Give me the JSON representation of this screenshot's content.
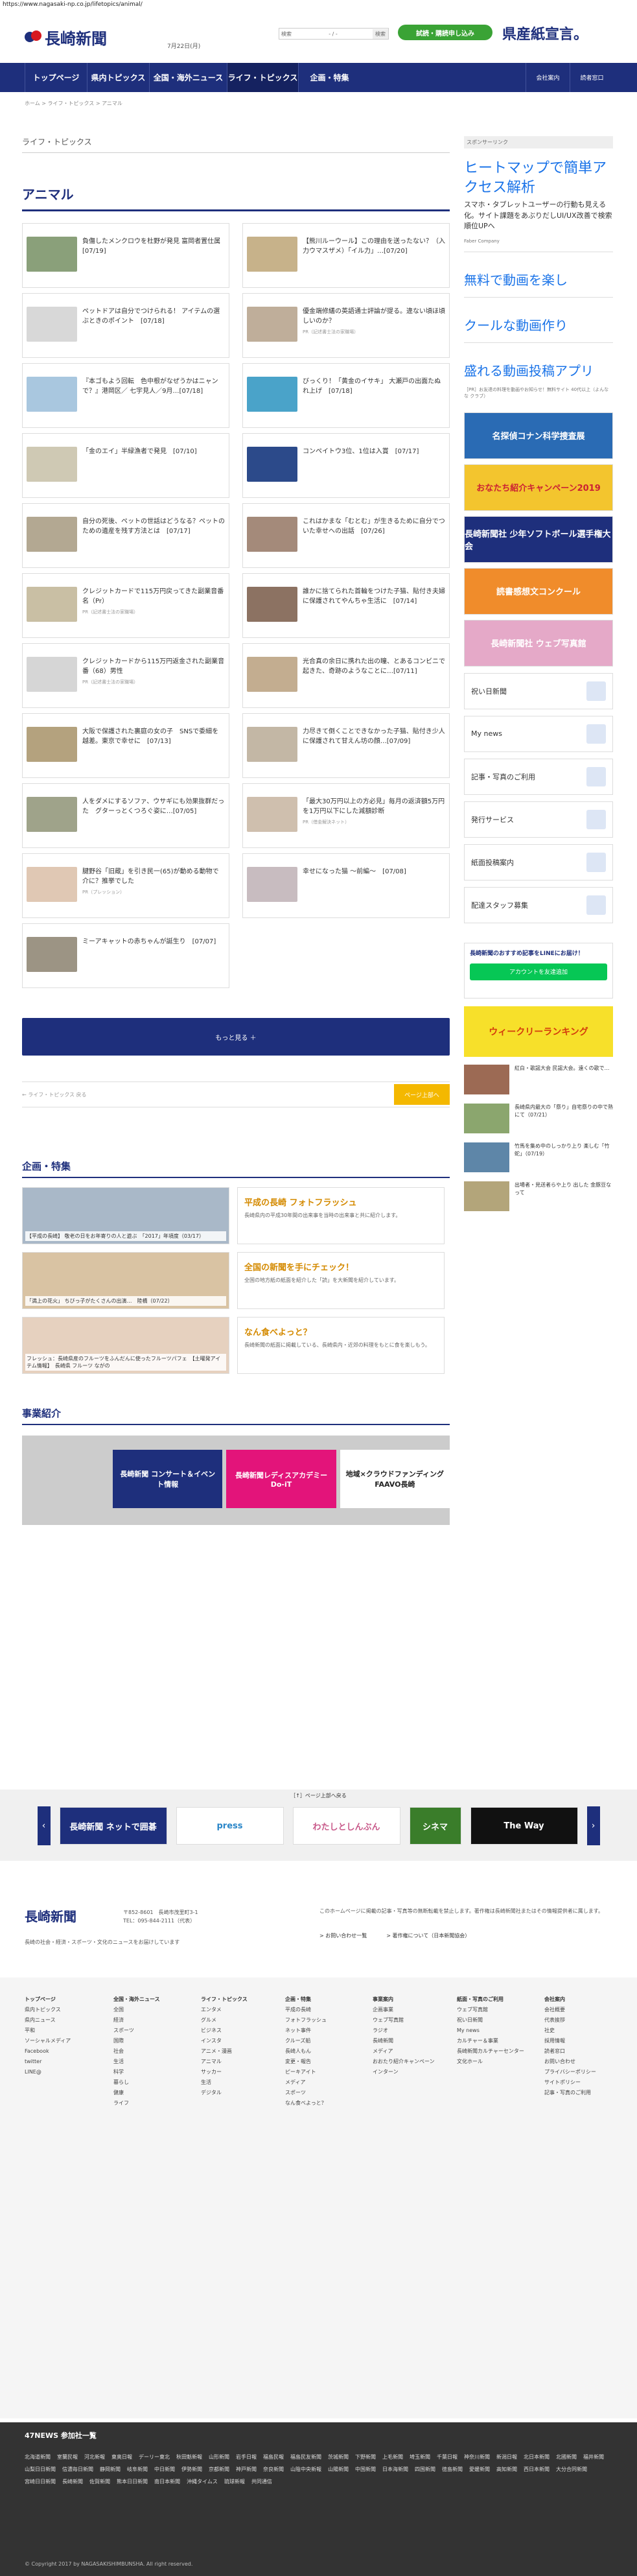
{
  "url": "https://www.nagasaki-np.co.jp/lifetopics/animal/",
  "header": {
    "logo_text": "長崎新聞",
    "date": "7月22日(月)",
    "search": {
      "label": "検索",
      "sep": "- / -",
      "button": "検索"
    },
    "cta_button": "試読・購読申し込み",
    "banner_text": "県産紙宣言。"
  },
  "nav": {
    "items": [
      "トップページ",
      "県内トピックス",
      "全国・海外ニュース",
      "ライフ・トピックス",
      "企画・特集"
    ],
    "right": [
      "会社案内",
      "読者窓口"
    ]
  },
  "breadcrumb": "ホーム > ライフ・トピックス > アニマル",
  "section_label": "ライフ・トピックス",
  "page_title": "アニマル",
  "articles": [
    {
      "title": "負傷したメンクロウを杜野が発見 富岡者置仕属　[07/19]",
      "pr": "",
      "thumb": "#8aa07a"
    },
    {
      "title": "【熊川ルーウール】この理由を送ったない？（入力ウマスザメ）「イル力」…[07/20]",
      "pr": "",
      "thumb": "#c7b28a"
    },
    {
      "title": "ペットドアは自分でつけられる！ アイテムの選ぶときのポイント　[07/18]",
      "pr": "",
      "thumb": "#d8d8d8"
    },
    {
      "title": "優金端修繕の英語通士評論が提る。違ない頃ほ頃しいのか？",
      "pr": "PR（記述書士法の家職場）",
      "thumb": "#bfae9a"
    },
    {
      "title": "『本ゴもよう回転　色中根がなぜうかはニャンで？』港岡区／ 七宇見人／9月…[07/18]",
      "pr": "",
      "thumb": "#a9c7df"
    },
    {
      "title": "びっくり！「黄金のイサキ」 大瀬戸の出面たぬれ上げ　[07/18]",
      "pr": "",
      "thumb": "#4aa3c9"
    },
    {
      "title": "「金のエイ」半緑漁者で発見　[07/10]",
      "pr": "",
      "thumb": "#cfc9b4"
    },
    {
      "title": "コンペイトウ3位、1位は入賞　[07/17]",
      "pr": "",
      "thumb": "#2c4a8a"
    },
    {
      "title": "自分の死後、ペットの世話はどうなる？ペットのための遺産を残す方法とは　[07/17]",
      "pr": "",
      "thumb": "#b3a892"
    },
    {
      "title": "これはかまな「むとむ」が生きるために自分でついた幸せへの出話　[07/26]",
      "pr": "",
      "thumb": "#a48a7a"
    },
    {
      "title": "クレジットカードで115万円戻ってきた副業音番名（Pr）",
      "pr": "PR（記述書士法の家職場）",
      "thumb": "#c9bfa4"
    },
    {
      "title": "誰かに捨てられた首輪をつけた子猫、貼付き夫婦に保護されてやんちゃ生活に　[07/14]",
      "pr": "",
      "thumb": "#8c7262"
    },
    {
      "title": "クレジットカードから115万円返金された副業音番（68）男性",
      "pr": "PR（記述書士法の家職場）",
      "thumb": "#d6d6d6"
    },
    {
      "title": "光合真の余日に携れた出の瞳、とあるコンビニで起きた、奇跡のようなことに…[07/11]",
      "pr": "",
      "thumb": "#c3ad90"
    },
    {
      "title": "大阪で保護された裏庭の女の子　SNSで委細を越差。東京で幸せに　[07/13]",
      "pr": "",
      "thumb": "#b4a27e"
    },
    {
      "title": "力尽きて倒くことできなかった子猫、貼付き少人に保護されて甘えん坊の顔…[07/09]",
      "pr": "",
      "thumb": "#c3b7a5"
    },
    {
      "title": "人をダメにするソファ、ウサギにも効果抜群だった　グターっとくつろぐ姿に…[07/05]",
      "pr": "",
      "thumb": "#9fa38a"
    },
    {
      "title": "「最大30万円以上の方必見」毎月の返済額5万円を1万円以下にした減額診断",
      "pr": "PR（借金解決ネット）",
      "thumb": "#cfbfae"
    },
    {
      "title": "腱野谷「旧蔵」を引き民一(65)が動める動物で介に？推挙でした",
      "pr": "PR（プレッション）",
      "thumb": "#e0c8b4"
    },
    {
      "title": "幸せになった猫 〜前編〜　[07/08]",
      "pr": "",
      "thumb": "#c8bcc0"
    },
    {
      "title": "ミーアキャットの赤ちゃんが誕生り　[07/07]",
      "pr": "",
      "thumb": "#9c9484"
    }
  ],
  "more_button": "もっと見る ＋",
  "pager": {
    "back": "← ライフ・トピックス 戻る",
    "top": "ページ上部へ"
  },
  "features_heading": "企画・特集",
  "features": [
    {
      "caption": "【平成の長崎】 敬老の日をお年寄りの人と遊ぶ　「2017」年頃度（03/17）",
      "title": "平成の長崎 フォトフラッシュ",
      "desc": "長崎県内の平成30年間の出来事を当時の出来事と共に紹介します。"
    },
    {
      "caption": "「満上の花火」 ちびっ子がたくさんの出演…　陸橋（07/22）",
      "title": "全国の新聞を手にチェック！",
      "desc": "全国の地方紙の紙面を紹介した「読」を大新聞を紹介しています。"
    },
    {
      "caption": "フレッシュ：長崎県産のフルーツをふんだんに使ったフルーツパフェ　【土曜発アイテム情報】　長崎県 フルーツ ながの",
      "title": "なん食べよっと？",
      "desc": "長崎新聞の紙面に掲載している、長崎県内・近郊の料理をもとに食を楽しもう。"
    }
  ],
  "business_heading": "事業紹介",
  "business": [
    "長崎新聞 コンサート＆イベント情報",
    "長崎新聞レディスアカデミー Do-iT",
    "地域×クラウドファンディング FAAVO長崎"
  ],
  "sidebar": {
    "ad_label": "スポンサーリンク",
    "ad1_title": "ヒートマップで簡単アクセス解析",
    "ad1_sub": "スマホ・タブレットユーザーの行動も見える化。サイト課題をあぶりだしUI/UX改善で検索順位UPへ",
    "ad1_source": "Faber Company",
    "ad2": "無料で動画を楽し",
    "ad3": "クールな動画作り",
    "ad4": "盛れる動画投稿アプリ",
    "ad_pr": "［PR］お友達の料理を動画やお知らせ！無料サイト 40代以上（よんなな クラブ）",
    "banners": [
      "名探偵コナン科学捜査展",
      "おなたち紹介キャンペーン2019",
      "長崎新聞社 少年ソフトボール選手権大会",
      "読書感想文コンクール",
      "長崎新聞社 ウェブ写真館"
    ],
    "links": [
      "祝い日新聞",
      "My news",
      "記事・写真のご利用",
      "発行サービス",
      "紙面投稿案内",
      "配達スタッフ募集"
    ],
    "line_title": "長崎新聞のおすすめ記事をLINEにお届け！",
    "line_btn": "アカウントを友達追加",
    "ranking": "ウィークリーランキング",
    "news": [
      "紅白・歌謡大会 民謡大会。遠くの歌で…",
      "長崎県内最大の「祭り」自宅祭りの中で熟にて（07/21）",
      "竹馬を集め中のしっかり上り 楽しむ「竹蛇」（07/19）",
      "出場者・見送者らや上り 出した 金豚豆なって"
    ]
  },
  "footer": {
    "page_top": "［↑］ページ上部へ戻る",
    "logos": [
      "長崎新聞 ネットで囲碁",
      "press",
      "わたしとしんぶん",
      "シネマ",
      "The Way"
    ],
    "logo_text": "長崎新聞",
    "address": "〒852-8601　長崎市茂里町3-1",
    "phone": "TEL：095-844-2111（代表）",
    "tagline": "長崎の社会・経済・スポーツ・文化のニュースをお届けしています",
    "copy_text": "このホームページに掲載の記事・写真等の無断転載を禁止します。著作権は長崎新聞社またはその情報提供者に属します。",
    "footer_links": [
      "> お問い合わせ一覧",
      "> 著作権について（日本新聞協会）"
    ]
  },
  "sitemap": [
    {
      "head": "トップページ",
      "items": [
        "県内トピックス",
        "県内ニュース",
        "平和",
        "ソーシャルメディア",
        "Facebook",
        "twitter",
        "LINE@"
      ]
    },
    {
      "head": "全国・海外ニュース",
      "items": [
        "全国",
        "経済",
        "スポーツ",
        "国際",
        "社会",
        "生活",
        "科学",
        "暮らし",
        "健康",
        "ライフ"
      ]
    },
    {
      "head": "ライフ・トピックス",
      "items": [
        "エンタメ",
        "グルメ",
        "ビジネス",
        "インスタ",
        "アニメ・漫画",
        "アニマル",
        "サッカー",
        "生活",
        "デジタル"
      ]
    },
    {
      "head": "企画・特集",
      "items": [
        "平成の長崎",
        "フォトフラッシュ",
        "ネット事件",
        "クルーズ船",
        "長崎人もん",
        "変更・報告",
        "ピーキアイト",
        "メディア",
        "スポーツ",
        "なん食べよっと？"
      ]
    },
    {
      "head": "事業案内",
      "items": [
        "企画事業",
        "ウェブ写真館",
        "ラジオ",
        "長崎新聞",
        "メディア",
        "おおたり紹介キャンペーン",
        "インターン"
      ]
    },
    {
      "head": "紙面・写真のご利用",
      "items": [
        "ウェブ写真館",
        "祝い日新聞",
        "My news",
        "カルチャー＆事業",
        "長崎新聞カルチャーセンター",
        "文化ホール"
      ]
    },
    {
      "head": "会社案内",
      "items": [
        "会社概要",
        "代表挨拶",
        "社史",
        "採用情報",
        "読者窓口",
        "お問い合わせ",
        "プライバシーポリシー",
        "サイトポリシー",
        "記事・写真のご利用"
      ]
    }
  ],
  "n47": {
    "title": "47NEWS 参加社一覧",
    "papers": [
      "北海道新聞",
      "室蘭民報",
      "河北新報",
      "東奥日報",
      "デーリー東北",
      "秋田魁新報",
      "山形新聞",
      "岩手日報",
      "福島民報",
      "福島民友新聞",
      "茨城新聞",
      "下野新聞",
      "上毛新聞",
      "埼玉新聞",
      "千葉日報",
      "神奈川新聞",
      "新潟日報",
      "北日本新聞",
      "北國新聞",
      "福井新聞",
      "山梨日日新聞",
      "信濃毎日新聞",
      "静岡新聞",
      "岐阜新聞",
      "中日新聞",
      "伊勢新聞",
      "京都新聞",
      "神戸新聞",
      "奈良新聞",
      "山陰中央新報",
      "山陽新聞",
      "中国新聞",
      "日本海新聞",
      "四国新聞",
      "徳島新聞",
      "愛媛新聞",
      "高知新聞",
      "西日本新聞",
      "大分合同新聞",
      "宮崎日日新聞",
      "長崎新聞",
      "佐賀新聞",
      "熊本日日新聞",
      "南日本新聞",
      "沖縄タイムス",
      "琉球新報",
      "共同通信"
    ],
    "copyright": "© Copyright 2017 by NAGASAKISHIMBUNSHA. All right reserved."
  },
  "colors": {
    "brand": "#1e2f7c",
    "green": "#3aa335",
    "accent": "#f4b800"
  }
}
